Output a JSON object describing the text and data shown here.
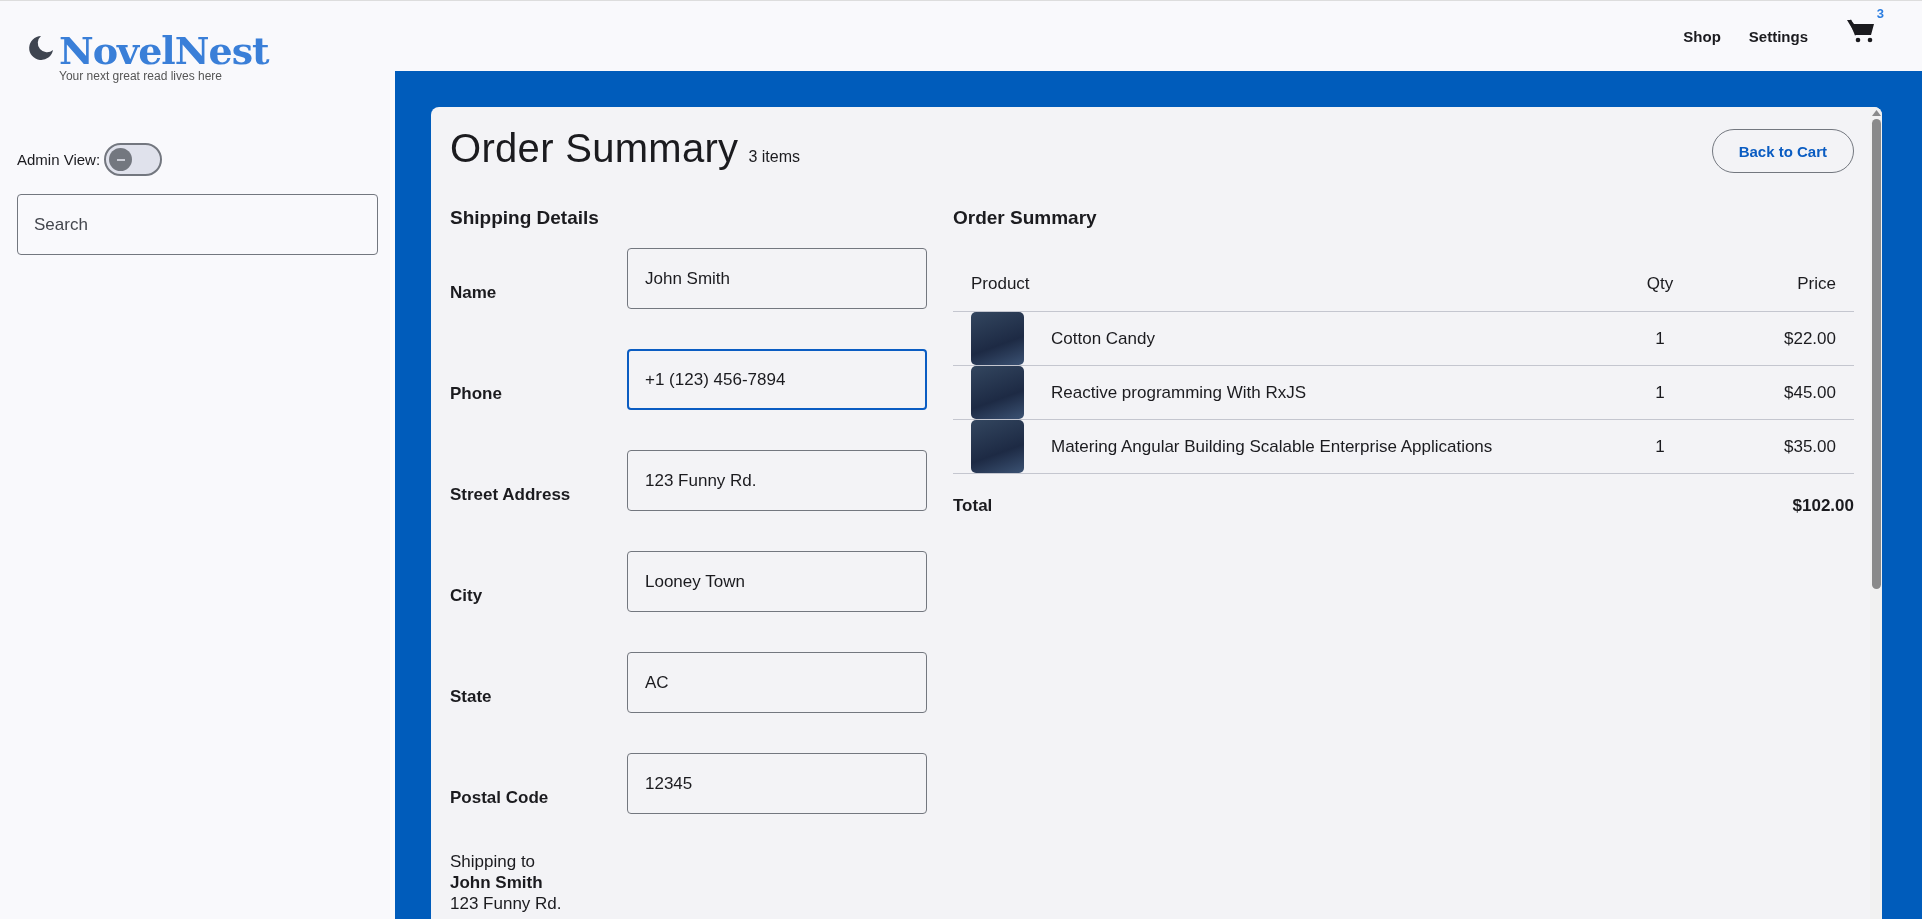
{
  "header": {
    "logo": {
      "title": "NovelNest",
      "tagline": "Your next great read lives here"
    },
    "nav": [
      {
        "label": "Shop"
      },
      {
        "label": "Settings"
      }
    ],
    "cart_count": "3"
  },
  "sidebar": {
    "admin_toggle": {
      "label": "Admin View:",
      "on": false
    },
    "search": {
      "placeholder": "Search"
    }
  },
  "order": {
    "title": "Order Summary",
    "item_count": "3 items",
    "back_button": "Back to Cart",
    "shipping": {
      "heading": "Shipping Details",
      "fields": [
        {
          "label": "Name",
          "value": "John Smith",
          "focused": false
        },
        {
          "label": "Phone",
          "value": "+1 (123) 456-7894",
          "focused": true
        },
        {
          "label": "Street Address",
          "value": "123 Funny Rd.",
          "focused": false
        },
        {
          "label": "City",
          "value": "Looney Town",
          "focused": false
        },
        {
          "label": "State",
          "value": "AC",
          "focused": false
        },
        {
          "label": "Postal Code",
          "value": "12345",
          "focused": false
        }
      ],
      "recipient": {
        "intro": "Shipping to",
        "name": "John Smith",
        "lines": [
          "123 Funny Rd."
        ]
      }
    },
    "summary": {
      "heading": "Order Summary",
      "columns": [
        "Product",
        "Qty",
        "Price"
      ],
      "rows": [
        {
          "product": "Cotton Candy",
          "qty": "1",
          "price": "$22.00"
        },
        {
          "product": "Reactive programming With RxJS",
          "qty": "1",
          "price": "$45.00"
        },
        {
          "product": "Matering Angular Building Scalable Enterprise Applications",
          "qty": "1",
          "price": "$35.00"
        }
      ],
      "total": {
        "label": "Total",
        "value": "$102.00"
      }
    }
  }
}
